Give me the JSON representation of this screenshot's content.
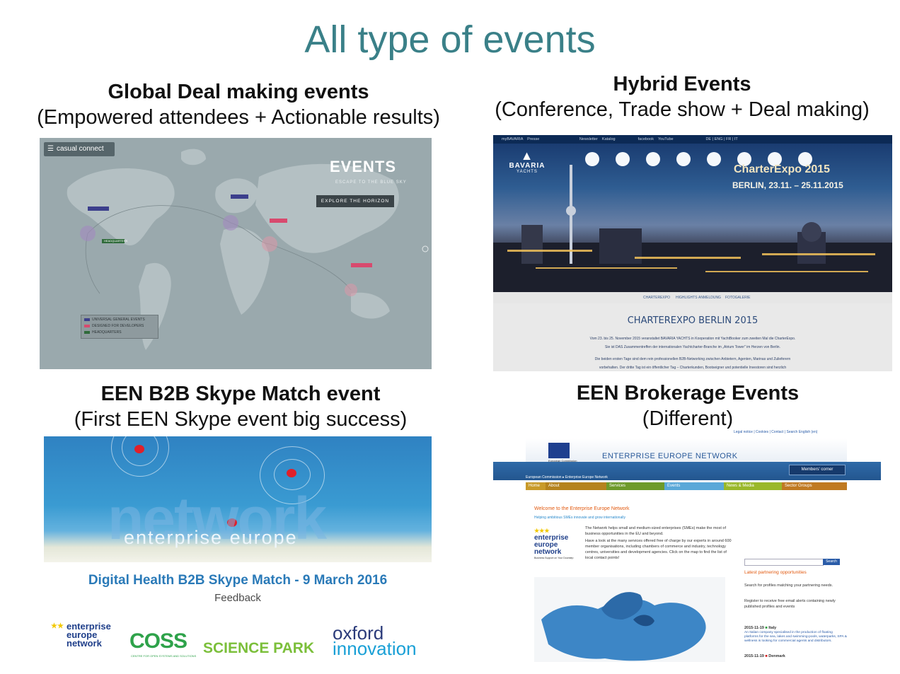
{
  "slide": {
    "title": "All type of events"
  },
  "quadrants": [
    {
      "heading": "Global Deal making events",
      "subheading": "(Empowered attendees + Actionable results)"
    },
    {
      "heading": "Hybrid Events",
      "subheading": "(Conference, Trade show + Deal making)"
    },
    {
      "heading": "EEN B2B Skype Match event",
      "subheading": "(First EEN Skype event big success)"
    },
    {
      "heading": "EEN Brokerage Events",
      "subheading": "(Different)"
    }
  ],
  "casual_connect": {
    "logo": "casual connect",
    "events_title": "EVENTS",
    "events_sub": "ESCAPE TO THE BLUE SKY",
    "explore_button": "EXPLORE THE HORIZON",
    "legend": [
      {
        "label": "UNIVERSAL GENERAL EVENTS",
        "color": "#3c3f8c"
      },
      {
        "label": "DESIGNED FOR DEVELOPERS",
        "color": "#d84a6e"
      },
      {
        "label": "HEADQUARTERS",
        "color": "#2f6b3a"
      }
    ],
    "pins": [
      "HEADQUARTERS"
    ]
  },
  "charter_expo": {
    "topbar": "myBAVARIA    Presse                                     Newsletter    Katalog                     facebook    YouTube                              DE | ENG | FR | IT",
    "brand": "BAVARIA",
    "brand_sub": "YACHTS",
    "expo_title": "CharterExpo 2015",
    "expo_dates": "BERLIN, 23.11. – 25.11.2015",
    "nav": [
      "CHARTEREXPO",
      "HIGHLIGHTS",
      "ANMELDUNG",
      "FOTOGALERIE"
    ],
    "heading": "CHARTEREXPO BERLIN 2015",
    "text": [
      "Vom 23. bis 25. November 2015 veranstaltet BAVARIA YACHTS in Kooperation mit YachtBooker zum zweiten Mal die CharterExpo.",
      "Sie ist DAS Zusammentreffen der internationalen Yachtcharter-Branche im „Atrium Tower\" im Herzen von Berlin.",
      "Die beiden ersten Tage sind dem rein professionellen B2B-Networking zwischen Anbietern, Agenten, Marinas und Zulieferern",
      "vorbehalten. Der dritte Tag ist ein öffentlicher Tag – Charterkunden, Bootseigner und potentielle Investoren sind herzlich"
    ]
  },
  "skype_match": {
    "network_word": "network",
    "enterprise_europe": "enterprise europe",
    "event_title": "Digital Health B2B Skype Match - 9 March 2016",
    "feedback": "Feedback",
    "logos": {
      "een": [
        "enterprise",
        "europe",
        "network"
      ],
      "coss": "COSS",
      "coss_sub": "CENTRE FOR OPEN SYSTEMS AND SOLUTIONS",
      "science_park": "SCIENCE PARK",
      "oxford": "oxford",
      "innovation": "innovation"
    }
  },
  "een_site": {
    "utility": "Legal notice | Cookies | Contact | Search  English (en)",
    "network_name": "ENTERPRISE EUROPE NETWORK",
    "flag_caption": "European Commission",
    "members_corner": "Members' corner",
    "breadcrumb": "European Commission ▸ Enterprise Europe Network",
    "tabs": [
      {
        "label": "Home",
        "color": "#c89a2a"
      },
      {
        "label": "About",
        "color": "#b5831e"
      },
      {
        "label": "Services",
        "color": "#6e9a2a"
      },
      {
        "label": "Events",
        "color": "#5aa8d8"
      },
      {
        "label": "News & Media",
        "color": "#9ab82a"
      },
      {
        "label": "Sector Groups",
        "color": "#c07a22"
      }
    ],
    "welcome": "Welcome to the Enterprise Europe Network",
    "helping": "Helping ambitious SMEs innovate and grow internationally",
    "body_1": "The Network helps small and medium-sized enterprises (SMEs) make the most of business opportunities in the EU and beyond.",
    "body_2": "Have a look at the many services offered free of charge by our experts in around 600 member organisations, including chambers of commerce and industry, technology centres, universities and development agencies. Click on the map to find the list of local contact points!",
    "logo_lines": [
      "enterprise",
      "europe",
      "network"
    ],
    "logo_caption": "Business Support on Your Doorstep",
    "search_button": "Search",
    "latest": "Latest partnering opportunities",
    "search_text": "Search for profiles matching your partnering needs.",
    "register_text": "Register to receive free email alerts containing newly published profiles and events",
    "item1_date": "2015-11-19",
    "item1_country": "Italy",
    "item1_text": "An Italian company specialised in the production of floating platforms for the sea, lakes and swimming-pools, waterparks, SPA & wellness is looking for commercial agents and distributors.",
    "item2_date": "2015-11-19",
    "item2_country": "Denmark"
  }
}
